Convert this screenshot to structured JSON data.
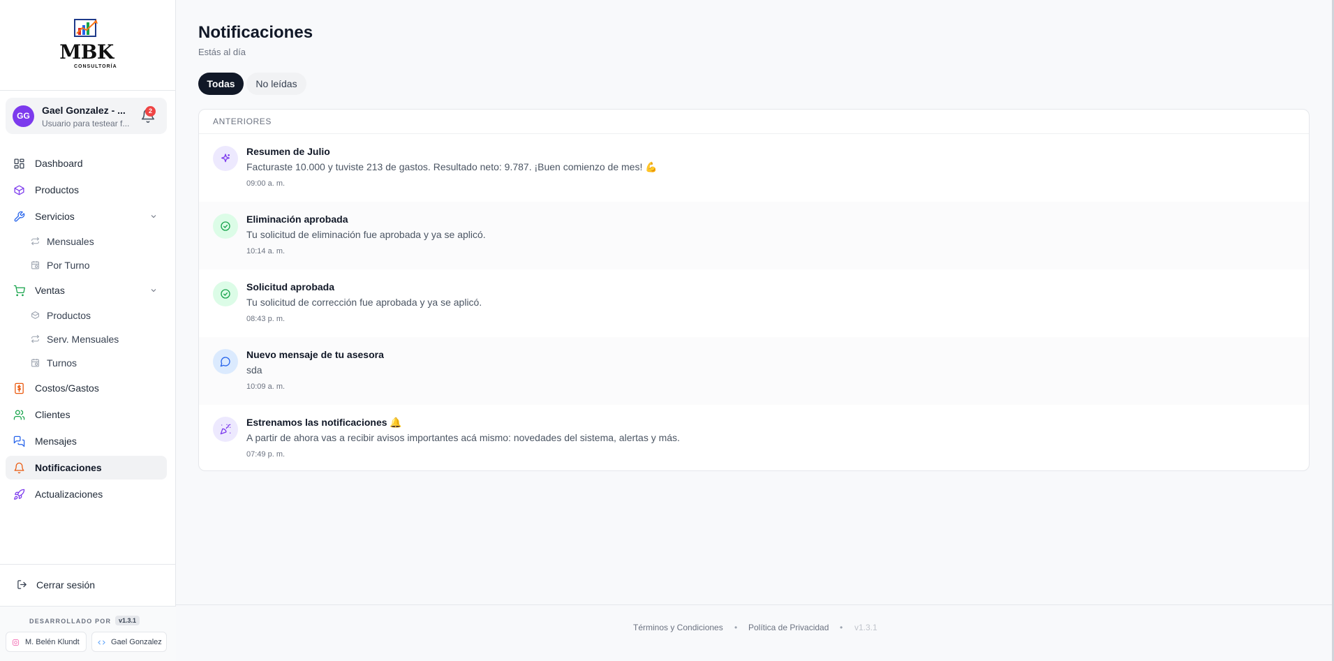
{
  "brand": {
    "logo_text": "MBK",
    "logo_sub": "CONSULTORÍA"
  },
  "user": {
    "initials": "GG",
    "name": "Gael Gonzalez - ...",
    "subtitle": "Usuario para testear f...",
    "notif_count": "2",
    "avatar_color": "#7c3aed"
  },
  "nav": {
    "dashboard": "Dashboard",
    "productos": "Productos",
    "servicios": "Servicios",
    "servicios_sub": [
      "Mensuales",
      "Por Turno"
    ],
    "ventas": "Ventas",
    "ventas_sub": [
      "Productos",
      "Serv. Mensuales",
      "Turnos"
    ],
    "costos": "Costos/Gastos",
    "clientes": "Clientes",
    "mensajes": "Mensajes",
    "notificaciones": "Notificaciones",
    "actualizaciones": "Actualizaciones"
  },
  "logout_label": "Cerrar sesión",
  "dev": {
    "label": "DESARROLLADO POR",
    "version": "v1.3.1",
    "dev1": "M. Belén Klundt",
    "dev2": "Gael Gonzalez"
  },
  "page": {
    "title": "Notificaciones",
    "subtitle": "Estás al día"
  },
  "tabs": {
    "all": "Todas",
    "unread": "No leídas"
  },
  "section_label": "ANTERIORES",
  "notifications": [
    {
      "title": "Resumen de Julio",
      "body": "Facturaste 10.000 y tuviste 213 de gastos. Resultado neto: 9.787. ¡Buen comienzo de mes! 💪",
      "time": "09:00 a. m.",
      "icon": "sparkles-icon"
    },
    {
      "title": "Eliminación aprobada",
      "body": "Tu solicitud de eliminación fue aprobada y ya se aplicó.",
      "time": "10:14 a. m.",
      "icon": "check-circle-icon"
    },
    {
      "title": "Solicitud aprobada",
      "body": "Tu solicitud de corrección fue aprobada y ya se aplicó.",
      "time": "08:43 p. m.",
      "icon": "check-circle-icon"
    },
    {
      "title": "Nuevo mensaje de tu asesora",
      "body": "sda",
      "time": "10:09 a. m.",
      "icon": "message-icon"
    },
    {
      "title": "Estrenamos las notificaciones 🔔",
      "body": "A partir de ahora vas a recibir avisos importantes acá mismo: novedades del sistema, alertas y más.",
      "time": "07:49 p. m.",
      "icon": "party-icon"
    }
  ],
  "footer": {
    "terms": "Términos y Condiciones",
    "privacy": "Política de Privacidad",
    "version": "v1.3.1"
  },
  "colors": {
    "accent_dark": "#111827",
    "badge_red": "#ef4444",
    "purple": "#7c3aed",
    "green": "#16a34a",
    "blue": "#2563eb",
    "orange": "#ea580c"
  }
}
